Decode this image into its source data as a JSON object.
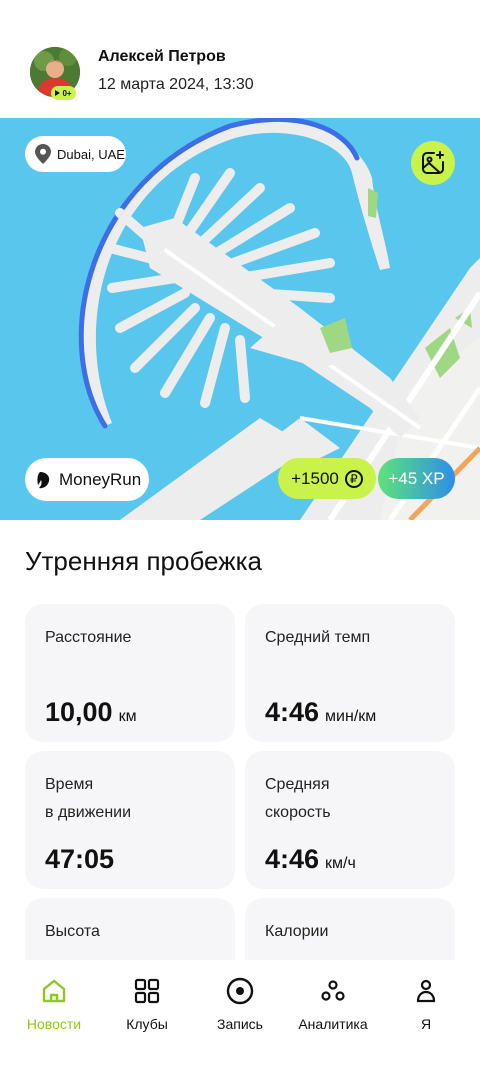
{
  "user": {
    "name": "Алексей Петров",
    "date": "12 марта 2024, 13:30",
    "badge_text": "0+"
  },
  "map": {
    "location": "Dubai, UAE",
    "brand": "MoneyRun",
    "reward": "+1500",
    "currency_symbol": "₽",
    "xp": "+45 XP",
    "route_color": "#3d6ee6"
  },
  "activity": {
    "title": "Утренняя пробежка",
    "stats": [
      {
        "label": "Расстояние",
        "value": "10,00",
        "unit": "км"
      },
      {
        "label": "Средний темп",
        "value": "4:46",
        "unit": "мин/км"
      },
      {
        "label": "Время\nв движении",
        "value": "47:05",
        "unit": ""
      },
      {
        "label": "Средняя\nскорость",
        "value": "4:46",
        "unit": "км/ч"
      },
      {
        "label": "Высота",
        "value": "",
        "unit": ""
      },
      {
        "label": "Калории",
        "value": "",
        "unit": ""
      }
    ]
  },
  "tabs": [
    {
      "label": "Новости",
      "icon": "home-icon",
      "active": true
    },
    {
      "label": "Клубы",
      "icon": "grid-icon",
      "active": false
    },
    {
      "label": "Запись",
      "icon": "record-icon",
      "active": false
    },
    {
      "label": "Аналитика",
      "icon": "analytics-icon",
      "active": false
    },
    {
      "label": "Я",
      "icon": "profile-icon",
      "active": false
    }
  ],
  "colors": {
    "accent": "#c9f24a",
    "active_tab": "#8cc91c",
    "water": "#59c6ee"
  }
}
